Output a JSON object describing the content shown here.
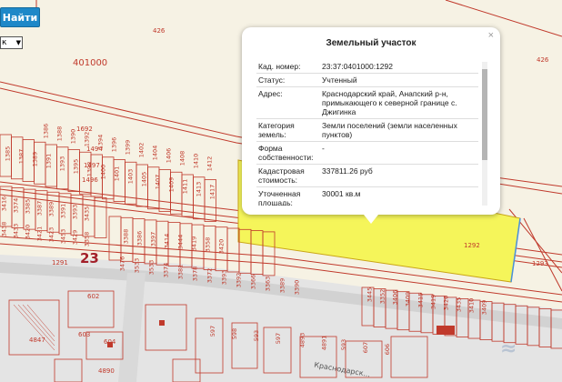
{
  "toolbar": {
    "search_label": "Найти",
    "select_value": "к"
  },
  "map": {
    "labels": {
      "n426a": "426",
      "n426b": "426",
      "n401000": "401000",
      "n23": "23",
      "n1291": "1291",
      "n1292": "1292",
      "n1293": "1293",
      "n1692": "1692",
      "n1494": "1494",
      "n1497": "1497",
      "n1496": "1496",
      "n602": "602",
      "n603": "603",
      "n604": "604",
      "n4847": "4847",
      "n4890": "4890",
      "street": "Краснодарск..."
    },
    "parcels_row1": [
      "1385",
      "1387",
      "1389",
      "1391",
      "1393",
      "1395",
      "1398",
      "1400",
      "1401",
      "1403",
      "1405",
      "1407",
      "1409",
      "1411",
      "1413",
      "1417"
    ],
    "parcels_row1_top": [
      "1386",
      "1388",
      "1390",
      "1392",
      "1394",
      "1396",
      "1399",
      "1402",
      "1404",
      "1406",
      "1408",
      "1410",
      "1412"
    ],
    "parcels_row2": [
      "3416",
      "3374",
      "3385",
      "3387",
      "3389",
      "3391",
      "3393",
      "3435"
    ],
    "parcels_row2b": [
      "3438",
      "3433",
      "3420",
      "3421",
      "3423",
      "3453",
      "3429",
      "3358"
    ],
    "parcels_row3": [
      "3388",
      "3386",
      "3397",
      "3414",
      "3444",
      "3419",
      "3358",
      "3420"
    ],
    "parcels_row4": [
      "3476",
      "3533",
      "3533",
      "3374",
      "3381",
      "3378",
      "3372",
      "3393",
      "3392",
      "3366",
      "3363",
      "3389",
      "3390"
    ],
    "parcels_row5": [
      "3445",
      "3352",
      "3406",
      "3409",
      "3415",
      "3419",
      "3420",
      "3435",
      "3410",
      "3409"
    ],
    "parcels_row6": [
      "597",
      "598",
      "593",
      "597",
      "4893",
      "4891",
      "593",
      "607",
      "606"
    ]
  },
  "popup": {
    "title": "Земельный участок",
    "close": "×",
    "rows": [
      {
        "key": "Кад. номер:",
        "value": "23:37:0401000:1292"
      },
      {
        "key": "Статус:",
        "value": "Учтенный"
      },
      {
        "key": "Адрес:",
        "value": "Краснодарский край, Анапский р-н, примыкающего к северной границе с. Джигинка"
      },
      {
        "key": "Категория земель:",
        "value": "Земли поселений (земли населенных пунктов)"
      },
      {
        "key": "Форма собственности:",
        "value": "-"
      },
      {
        "key": "Кадастровая стоимость:",
        "value": "337811.26 руб"
      },
      {
        "key": "Уточненная площадь:",
        "value": "30001 кв.м"
      }
    ]
  },
  "colors": {
    "parcel_line": "#c0392b",
    "highlight_fill": "#f5f55a",
    "button": "#1e88c8"
  }
}
